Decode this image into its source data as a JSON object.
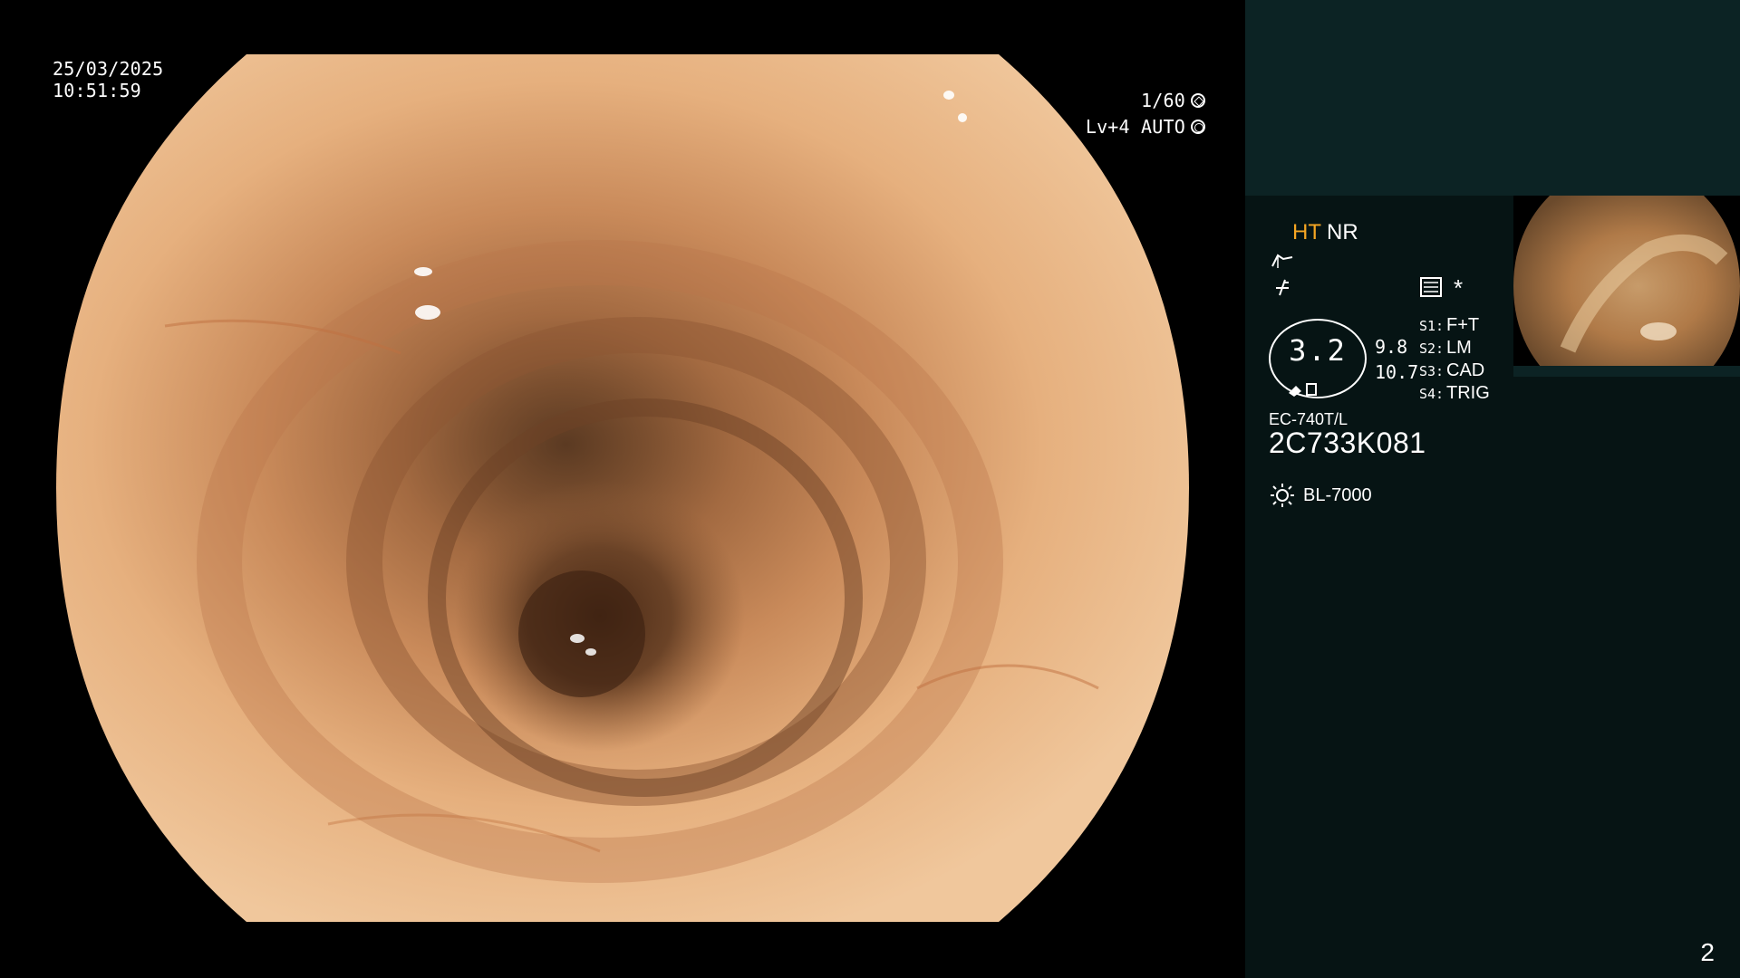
{
  "overlay": {
    "date": "25/03/2025",
    "time": "10:51:59",
    "shutter": "1/60",
    "level": "Lv+4 AUTO"
  },
  "panel": {
    "ht": "HT",
    "nr": "NR",
    "asterisk": "*",
    "iris_value": "3.2",
    "value_1": "9.8",
    "value_2": "10.7",
    "switches": [
      {
        "key": "S1:",
        "value": "F+T"
      },
      {
        "key": "S2:",
        "value": "LM"
      },
      {
        "key": "S3:",
        "value": "CAD"
      },
      {
        "key": "S4:",
        "value": "TRIG"
      }
    ],
    "scope_model": "EC-740T/L",
    "scope_serial": "2C733K081",
    "light_source": "BL-7000",
    "page_number": "2"
  },
  "icons": {
    "shutter": "shutter-icon",
    "auto": "auto-iris-icon",
    "enhance": "enhance-curve-icon",
    "tone": "tone-icon",
    "settings": "settings-list-icon",
    "light": "light-source-icon"
  },
  "colors": {
    "ht_accent": "#f5a623",
    "panel_bg": "#061414",
    "panel_top_bg": "#0c2324"
  }
}
